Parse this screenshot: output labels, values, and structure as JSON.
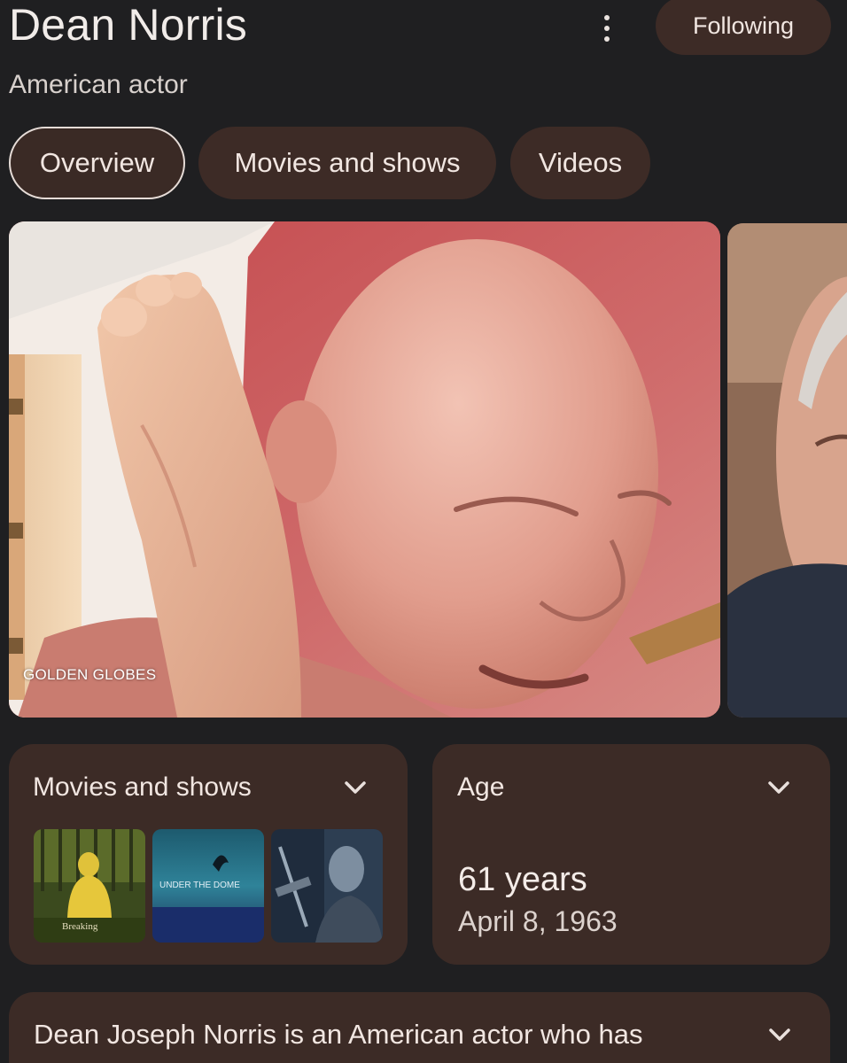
{
  "header": {
    "title": "Dean Norris",
    "subtitle": "American actor",
    "follow_label": "Following"
  },
  "tabs": [
    {
      "label": "Overview",
      "active": true
    },
    {
      "label": "Movies and shows",
      "active": false
    },
    {
      "label": "Videos",
      "active": false
    }
  ],
  "hero": {
    "source_label": "GOLDEN GLOBES"
  },
  "cards": {
    "movies": {
      "title": "Movies and shows",
      "thumbs": [
        {
          "label": "Breaking"
        },
        {
          "label": "UNDER THE DOME"
        },
        {
          "label": ""
        }
      ]
    },
    "age": {
      "title": "Age",
      "value": "61 years",
      "date": "April 8, 1963"
    },
    "description": {
      "text": "Dean Joseph Norris is an American actor who has"
    }
  },
  "icons": {
    "more": "more-vert-icon",
    "chevron": "chevron-down-icon"
  },
  "colors": {
    "background": "#1f1f21",
    "card": "#3c2b26",
    "chip": "#3d2b26",
    "text": "#f1e6e1"
  }
}
